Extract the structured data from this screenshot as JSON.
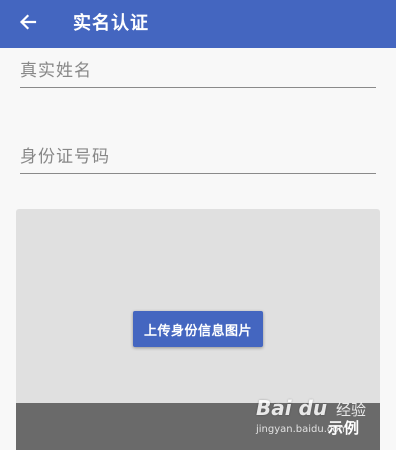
{
  "header": {
    "title": "实名认证",
    "back_icon": "arrow-left-icon",
    "background_color": "#4466c0"
  },
  "form": {
    "name_placeholder": "真实姓名",
    "id_placeholder": "身份证号码"
  },
  "upload": {
    "button_label": "上传身份信息图片",
    "example_label": "示例",
    "button_color": "#4466c0"
  },
  "watermark": {
    "logo": "Bai du",
    "text": "经验",
    "url": "jingyan.baidu.com"
  }
}
